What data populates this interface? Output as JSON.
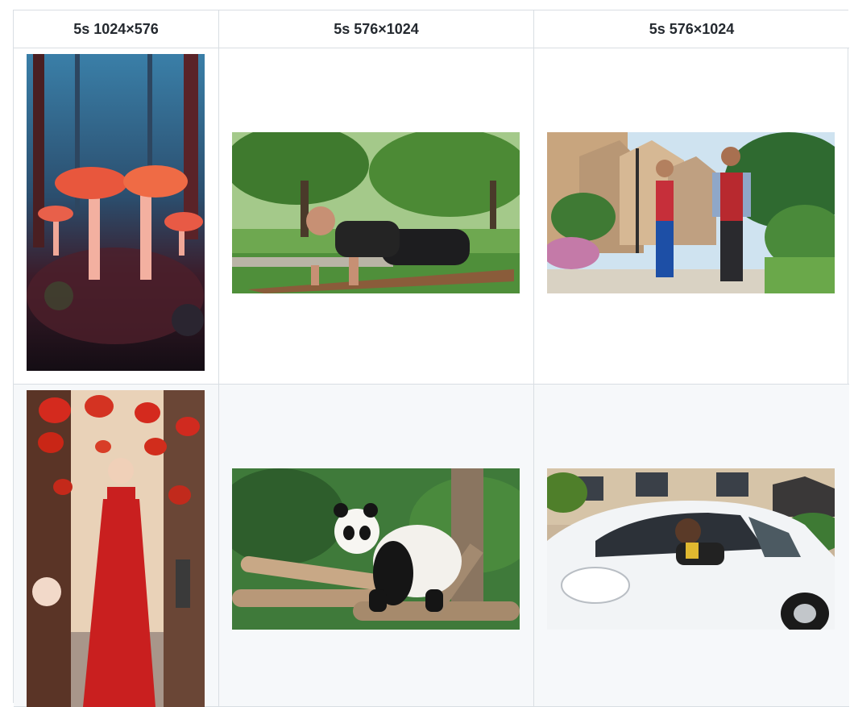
{
  "table": {
    "headers": [
      "5s 1024×576",
      "5s 576×1024",
      "5s 576×1024"
    ],
    "rows": [
      {
        "images": [
          {
            "subject": "mushrooms-forest-image"
          },
          {
            "subject": "man-pushup-park-image"
          },
          {
            "subject": "couple-jogging-street-image"
          }
        ]
      },
      {
        "images": [
          {
            "subject": "woman-red-dress-lanterns-image"
          },
          {
            "subject": "panda-on-logs-image"
          },
          {
            "subject": "woman-in-white-car-image"
          }
        ]
      }
    ]
  },
  "colors": {
    "border": "#d9dee3",
    "header_text": "#24292f",
    "row_alt_bg": "#f6f8fa"
  }
}
